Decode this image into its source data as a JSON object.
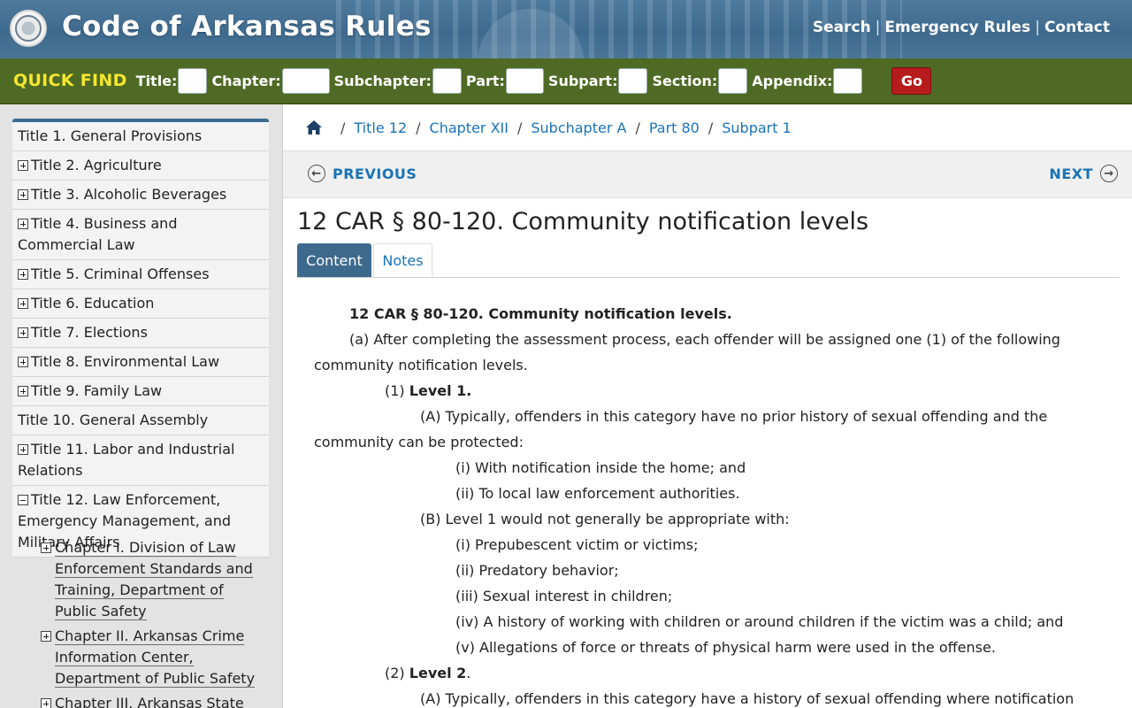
{
  "header": {
    "site_title": "Code of Arkansas Rules",
    "nav": [
      "Search",
      "Emergency Rules",
      "Contact"
    ],
    "nav_separator": "|"
  },
  "quickfind": {
    "title": "QUICK FIND",
    "fields": [
      "Title:",
      "Chapter:",
      "Subchapter:",
      "Part:",
      "Subpart:",
      "Section:",
      "Appendix:"
    ],
    "go_label": "Go"
  },
  "sidebar": {
    "titles": [
      "Title 1. General Provisions",
      "Title 2. Agriculture",
      "Title 3. Alcoholic Beverages",
      "Title 4. Business and Commercial Law",
      "Title 5. Criminal Offenses",
      "Title 6. Education",
      "Title 7. Elections",
      "Title 8. Environmental Law",
      "Title 9. Family Law",
      "Title 10. General Assembly",
      "Title 11. Labor and Industrial Relations",
      "Title 12. Law Enforcement, Emergency Management, and Military Affairs"
    ],
    "chapters": [
      "Chapter I. Division of Law Enforcement Standards and Training, Department of Public Safety",
      "Chapter II. Arkansas Crime Information Center, Department of Public Safety",
      "Chapter III. Arkansas State"
    ]
  },
  "breadcrumb": [
    "Title 12",
    "Chapter XII",
    "Subchapter A",
    "Part 80",
    "Subpart 1"
  ],
  "pager": {
    "previous": "PREVIOUS",
    "next": "NEXT"
  },
  "rule": {
    "title": "12 CAR § 80-120. Community notification levels",
    "tabs": [
      "Content",
      "Notes"
    ],
    "heading": "12 CAR § 80-120. Community notification levels.",
    "a": "(a) After completing the assessment process, each offender will be assigned one (1) of the following community notification levels.",
    "l1_num": "(1)",
    "l1_label": "Level 1.",
    "l1_A": "(A) Typically, offenders in this category have no prior history of sexual offending and the community can be protected:",
    "l1_A_i": "(i) With notification inside the home; and",
    "l1_A_ii": "(ii) To local law enforcement authorities.",
    "l1_B": "(B) Level 1 would not generally be appropriate with:",
    "l1_B_i": "(i) Prepubescent victim or victims;",
    "l1_B_ii": "(ii) Predatory behavior;",
    "l1_B_iii": "(iii) Sexual interest in children;",
    "l1_B_iv": "(iv) A history of working with children or around children if the victim was a child; and",
    "l1_B_v": "(v) Allegations of force or threats of physical harm were used in the offense.",
    "l2_num": "(2)",
    "l2_label": "Level 2",
    "l2_period": ".",
    "l2_A": "(A) Typically, offenders in this category have a history of sexual offending where notification"
  }
}
